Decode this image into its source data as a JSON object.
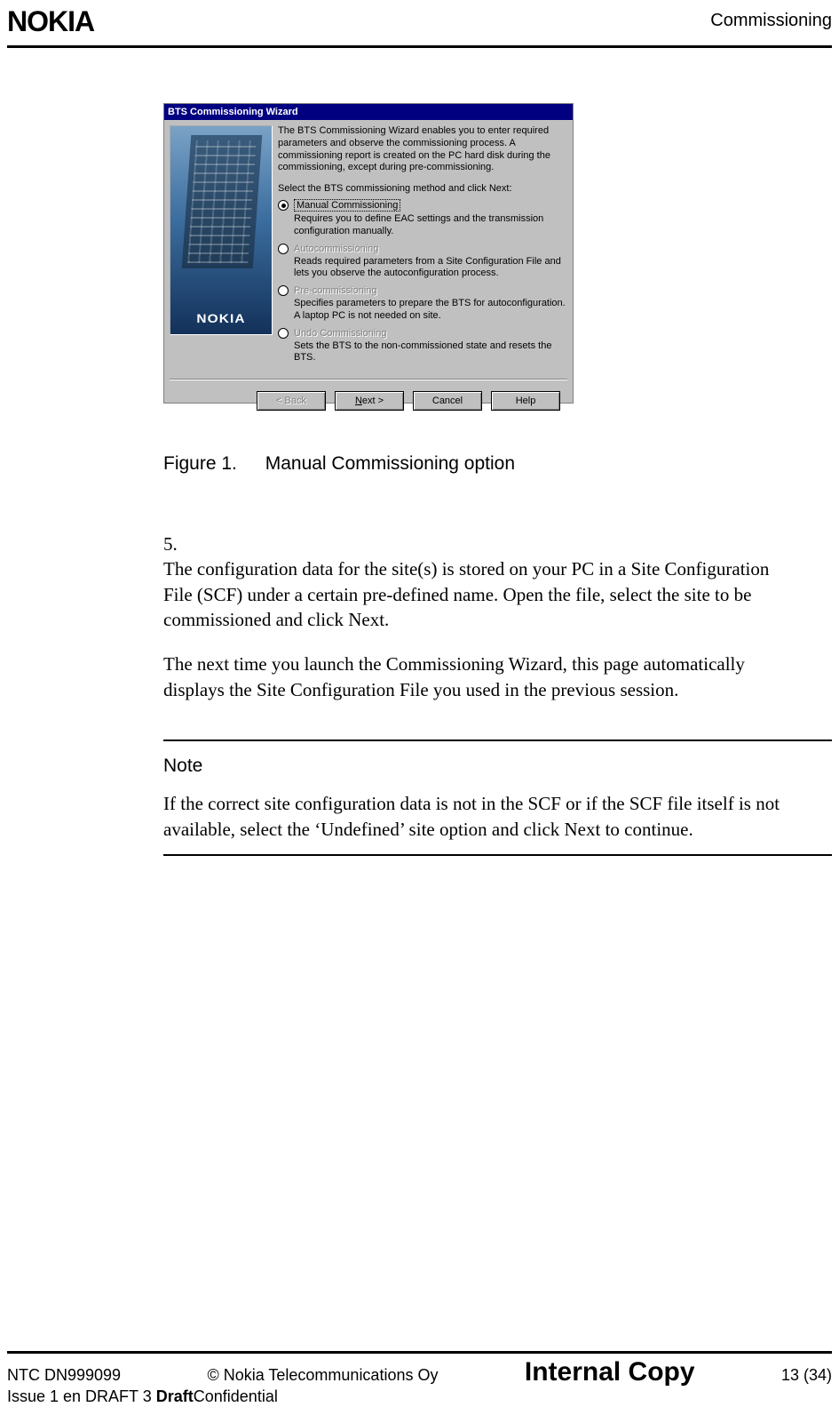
{
  "header": {
    "logo": "NOKIA",
    "section": "Commissioning"
  },
  "dialog": {
    "title": "BTS Commissioning Wizard",
    "side_brand": "NOKIA",
    "intro": "The BTS Commissioning Wizard enables you to enter required parameters and observe the commissioning process. A commissioning report is created on the PC hard disk during the commissioning, except during pre-commissioning.",
    "select_prompt": "Select the BTS commissioning method and click Next:",
    "options": [
      {
        "label": "Manual Commissioning",
        "desc": "Requires you to define EAC settings and the transmission configuration manually.",
        "checked": true,
        "enabled": true
      },
      {
        "label": "Autocommissioning",
        "desc": "Reads required parameters from a Site Configuration File and lets you observe the autoconfiguration process.",
        "checked": false,
        "enabled": false
      },
      {
        "label": "Pre-commissioning",
        "desc": "Specifies parameters to prepare the BTS for autoconfiguration. A laptop PC is not needed on site.",
        "checked": false,
        "enabled": false
      },
      {
        "label": "Undo Commissioning",
        "desc": "Sets the BTS to the non-commissioned state and resets the BTS.",
        "checked": false,
        "enabled": false
      }
    ],
    "buttons": {
      "back": "< Back",
      "next_prefix": "N",
      "next_rest": "ext >",
      "cancel": "Cancel",
      "help": "Help"
    }
  },
  "figure": {
    "label": "Figure 1.",
    "caption": "Manual Commissioning option"
  },
  "step": {
    "number": "5.",
    "p1": "The configuration data for the site(s) is stored on your PC in a Site Configuration File (SCF) under a certain pre-defined name. Open the file, select the site to be commissioned and click Next.",
    "p2": "The next time you launch the Commissioning Wizard, this page automatically displays the Site Configuration File you used in the previous session."
  },
  "note": {
    "heading": "Note",
    "text": "If the correct site configuration data is not in the SCF or if the SCF file itself is not available, select the ‘Undefined’ site option and click Next to continue."
  },
  "footer": {
    "left1": "NTC DN999099",
    "left2_a": "Issue 1 en DRAFT 3 ",
    "left2_b": "Draft",
    "center_top": "© Nokia Telecommunications Oy",
    "center_big": "Internal Copy",
    "center_bottom": "Confidential",
    "right": "13 (34)"
  }
}
